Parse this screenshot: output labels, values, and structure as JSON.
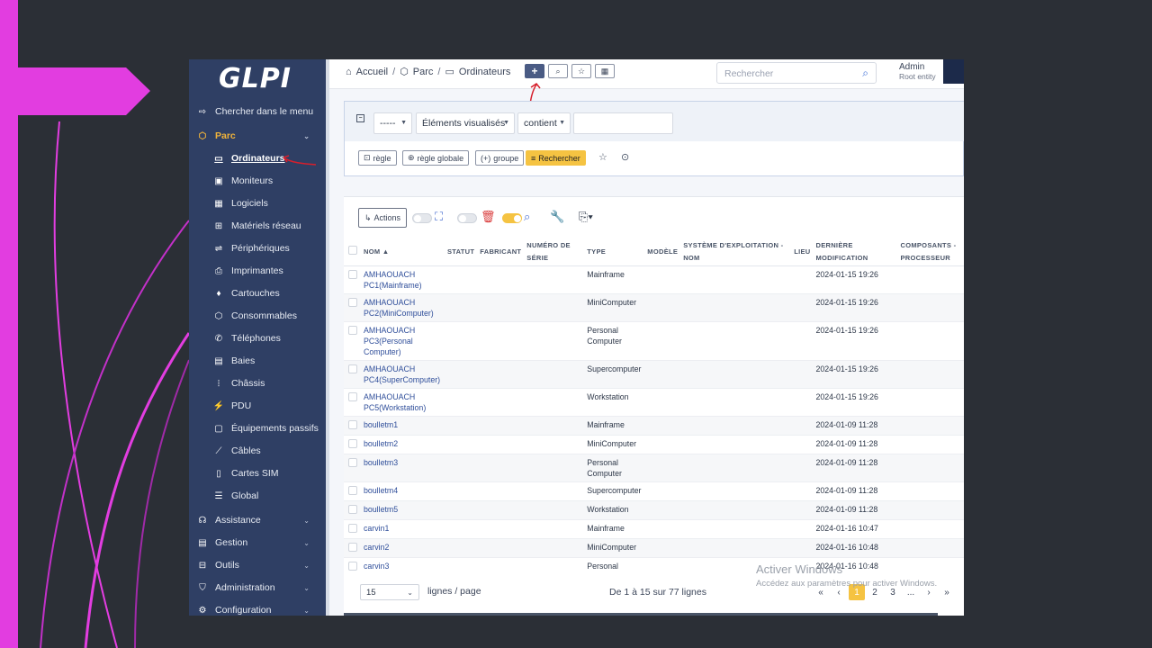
{
  "app": {
    "logo": "GLPI"
  },
  "sidebar": {
    "search_label": "Chercher dans le menu",
    "parc": {
      "label": "Parc",
      "icon": "cube-icon"
    },
    "items": [
      {
        "label": "Ordinateurs",
        "icon": "laptop-icon",
        "active": true
      },
      {
        "label": "Moniteurs",
        "icon": "monitor-icon"
      },
      {
        "label": "Logiciels",
        "icon": "apps-icon"
      },
      {
        "label": "Matériels réseau",
        "icon": "network-icon"
      },
      {
        "label": "Périphériques",
        "icon": "usb-icon"
      },
      {
        "label": "Imprimantes",
        "icon": "printer-icon"
      },
      {
        "label": "Cartouches",
        "icon": "droplet-icon"
      },
      {
        "label": "Consommables",
        "icon": "package-icon"
      },
      {
        "label": "Téléphones",
        "icon": "phone-icon"
      },
      {
        "label": "Baies",
        "icon": "server-icon"
      },
      {
        "label": "Châssis",
        "icon": "columns-icon"
      },
      {
        "label": "PDU",
        "icon": "plug-icon"
      },
      {
        "label": "Équipements passifs",
        "icon": "box-icon"
      },
      {
        "label": "Câbles",
        "icon": "cable-icon"
      },
      {
        "label": "Cartes SIM",
        "icon": "sim-icon"
      },
      {
        "label": "Global",
        "icon": "list-icon"
      }
    ],
    "categories": [
      {
        "label": "Assistance",
        "icon": "headset-icon"
      },
      {
        "label": "Gestion",
        "icon": "wallet-icon"
      },
      {
        "label": "Outils",
        "icon": "briefcase-icon"
      },
      {
        "label": "Administration",
        "icon": "shield-icon"
      },
      {
        "label": "Configuration",
        "icon": "gear-icon"
      }
    ]
  },
  "topbar": {
    "breadcrumb": [
      "Accueil",
      "Parc",
      "Ordinateurs"
    ],
    "search_placeholder": "Rechercher",
    "user_name": "Admin",
    "user_entity": "Root entity"
  },
  "criteria": {
    "field1": "-----",
    "field2": "Éléments visualisés",
    "operator": "contient",
    "value": "",
    "buttons": {
      "rule": "règle",
      "global_rule": "règle globale",
      "group": "groupe",
      "search": "Rechercher"
    }
  },
  "list": {
    "actions_label": "Actions",
    "columns": [
      "NOM",
      "STATUT",
      "FABRICANT",
      "NUMÉRO DE SÉRIE",
      "TYPE",
      "MODÈLE",
      "SYSTÈME D'EXPLOITATION - NOM",
      "LIEU",
      "DERNIÈRE MODIFICATION",
      "COMPOSANTS - PROCESSEUR"
    ],
    "rows": [
      {
        "name": "AMHAOUACH PC1(Mainframe)",
        "type": "Mainframe",
        "modified": "2024-01-15 19:26"
      },
      {
        "name": "AMHAOUACH PC2(MiniComputer)",
        "type": "MiniComputer",
        "modified": "2024-01-15 19:26"
      },
      {
        "name": "AMHAOUACH PC3(Personal Computer)",
        "type": "Personal Computer",
        "modified": "2024-01-15 19:26"
      },
      {
        "name": "AMHAOUACH PC4(SuperComputer)",
        "type": "Supercomputer",
        "modified": "2024-01-15 19:26"
      },
      {
        "name": "AMHAOUACH PC5(Workstation)",
        "type": "Workstation",
        "modified": "2024-01-15 19:26"
      },
      {
        "name": "boulletm1",
        "type": "Mainframe",
        "modified": "2024-01-09 11:28"
      },
      {
        "name": "boulletm2",
        "type": "MiniComputer",
        "modified": "2024-01-09 11:28"
      },
      {
        "name": "boulletm3",
        "type": "Personal Computer",
        "modified": "2024-01-09 11:28"
      },
      {
        "name": "boulletm4",
        "type": "Supercomputer",
        "modified": "2024-01-09 11:28"
      },
      {
        "name": "boulletm5",
        "type": "Workstation",
        "modified": "2024-01-09 11:28"
      },
      {
        "name": "carvin1",
        "type": "Mainframe",
        "modified": "2024-01-16 10:47"
      },
      {
        "name": "carvin2",
        "type": "MiniComputer",
        "modified": "2024-01-16 10:48"
      },
      {
        "name": "carvin3",
        "type": "Personal Computer",
        "modified": "2024-01-16 10:48"
      }
    ]
  },
  "footer": {
    "per_page": "15",
    "per_page_label": "lignes / page",
    "range": "De 1 à 15 sur 77 lignes",
    "pages": [
      "1",
      "2",
      "3",
      "..."
    ]
  },
  "watermark": {
    "title": "Activer Windows",
    "subtitle": "Accédez aux paramètres pour activer Windows."
  },
  "colors": {
    "sidebar": "#2f3f64",
    "accent": "#f5c342",
    "link": "#2f4e9a",
    "decor": "#e23de0"
  }
}
